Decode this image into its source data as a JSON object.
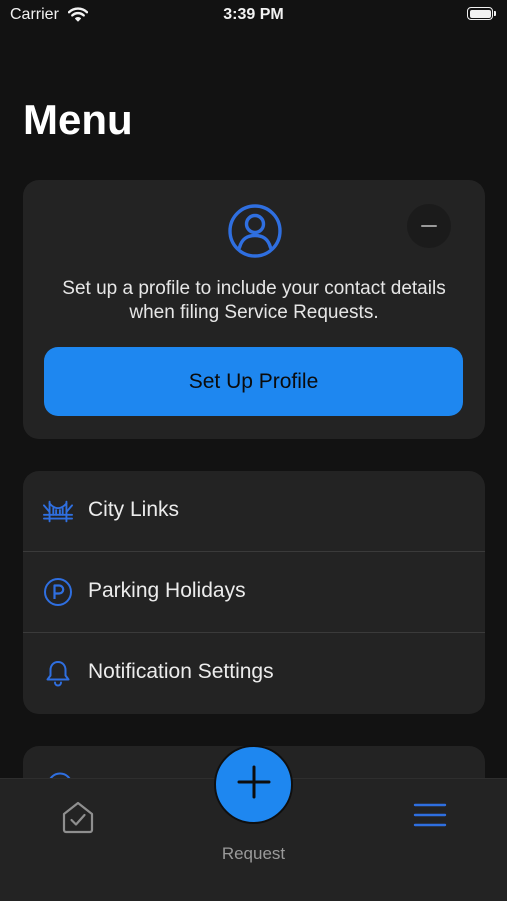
{
  "status_bar": {
    "carrier": "Carrier",
    "time": "3:39 PM"
  },
  "page_title": "Menu",
  "profile_card": {
    "message": "Set up a profile to include your contact details when filing Service Requests.",
    "button_label": "Set Up Profile"
  },
  "links": [
    {
      "label": "City Links",
      "icon": "bridge-icon"
    },
    {
      "label": "Parking Holidays",
      "icon": "parking-icon"
    },
    {
      "label": "Notification Settings",
      "icon": "bell-icon"
    }
  ],
  "tab_bar": {
    "request_label": "Request",
    "tabs": [
      "home-check-icon",
      "plus-icon",
      "hamburger-menu-icon"
    ]
  },
  "colors": {
    "accent": "#1e87f0",
    "icon_blue": "#2f6fe0",
    "background": "#121212",
    "card": "#232323"
  }
}
